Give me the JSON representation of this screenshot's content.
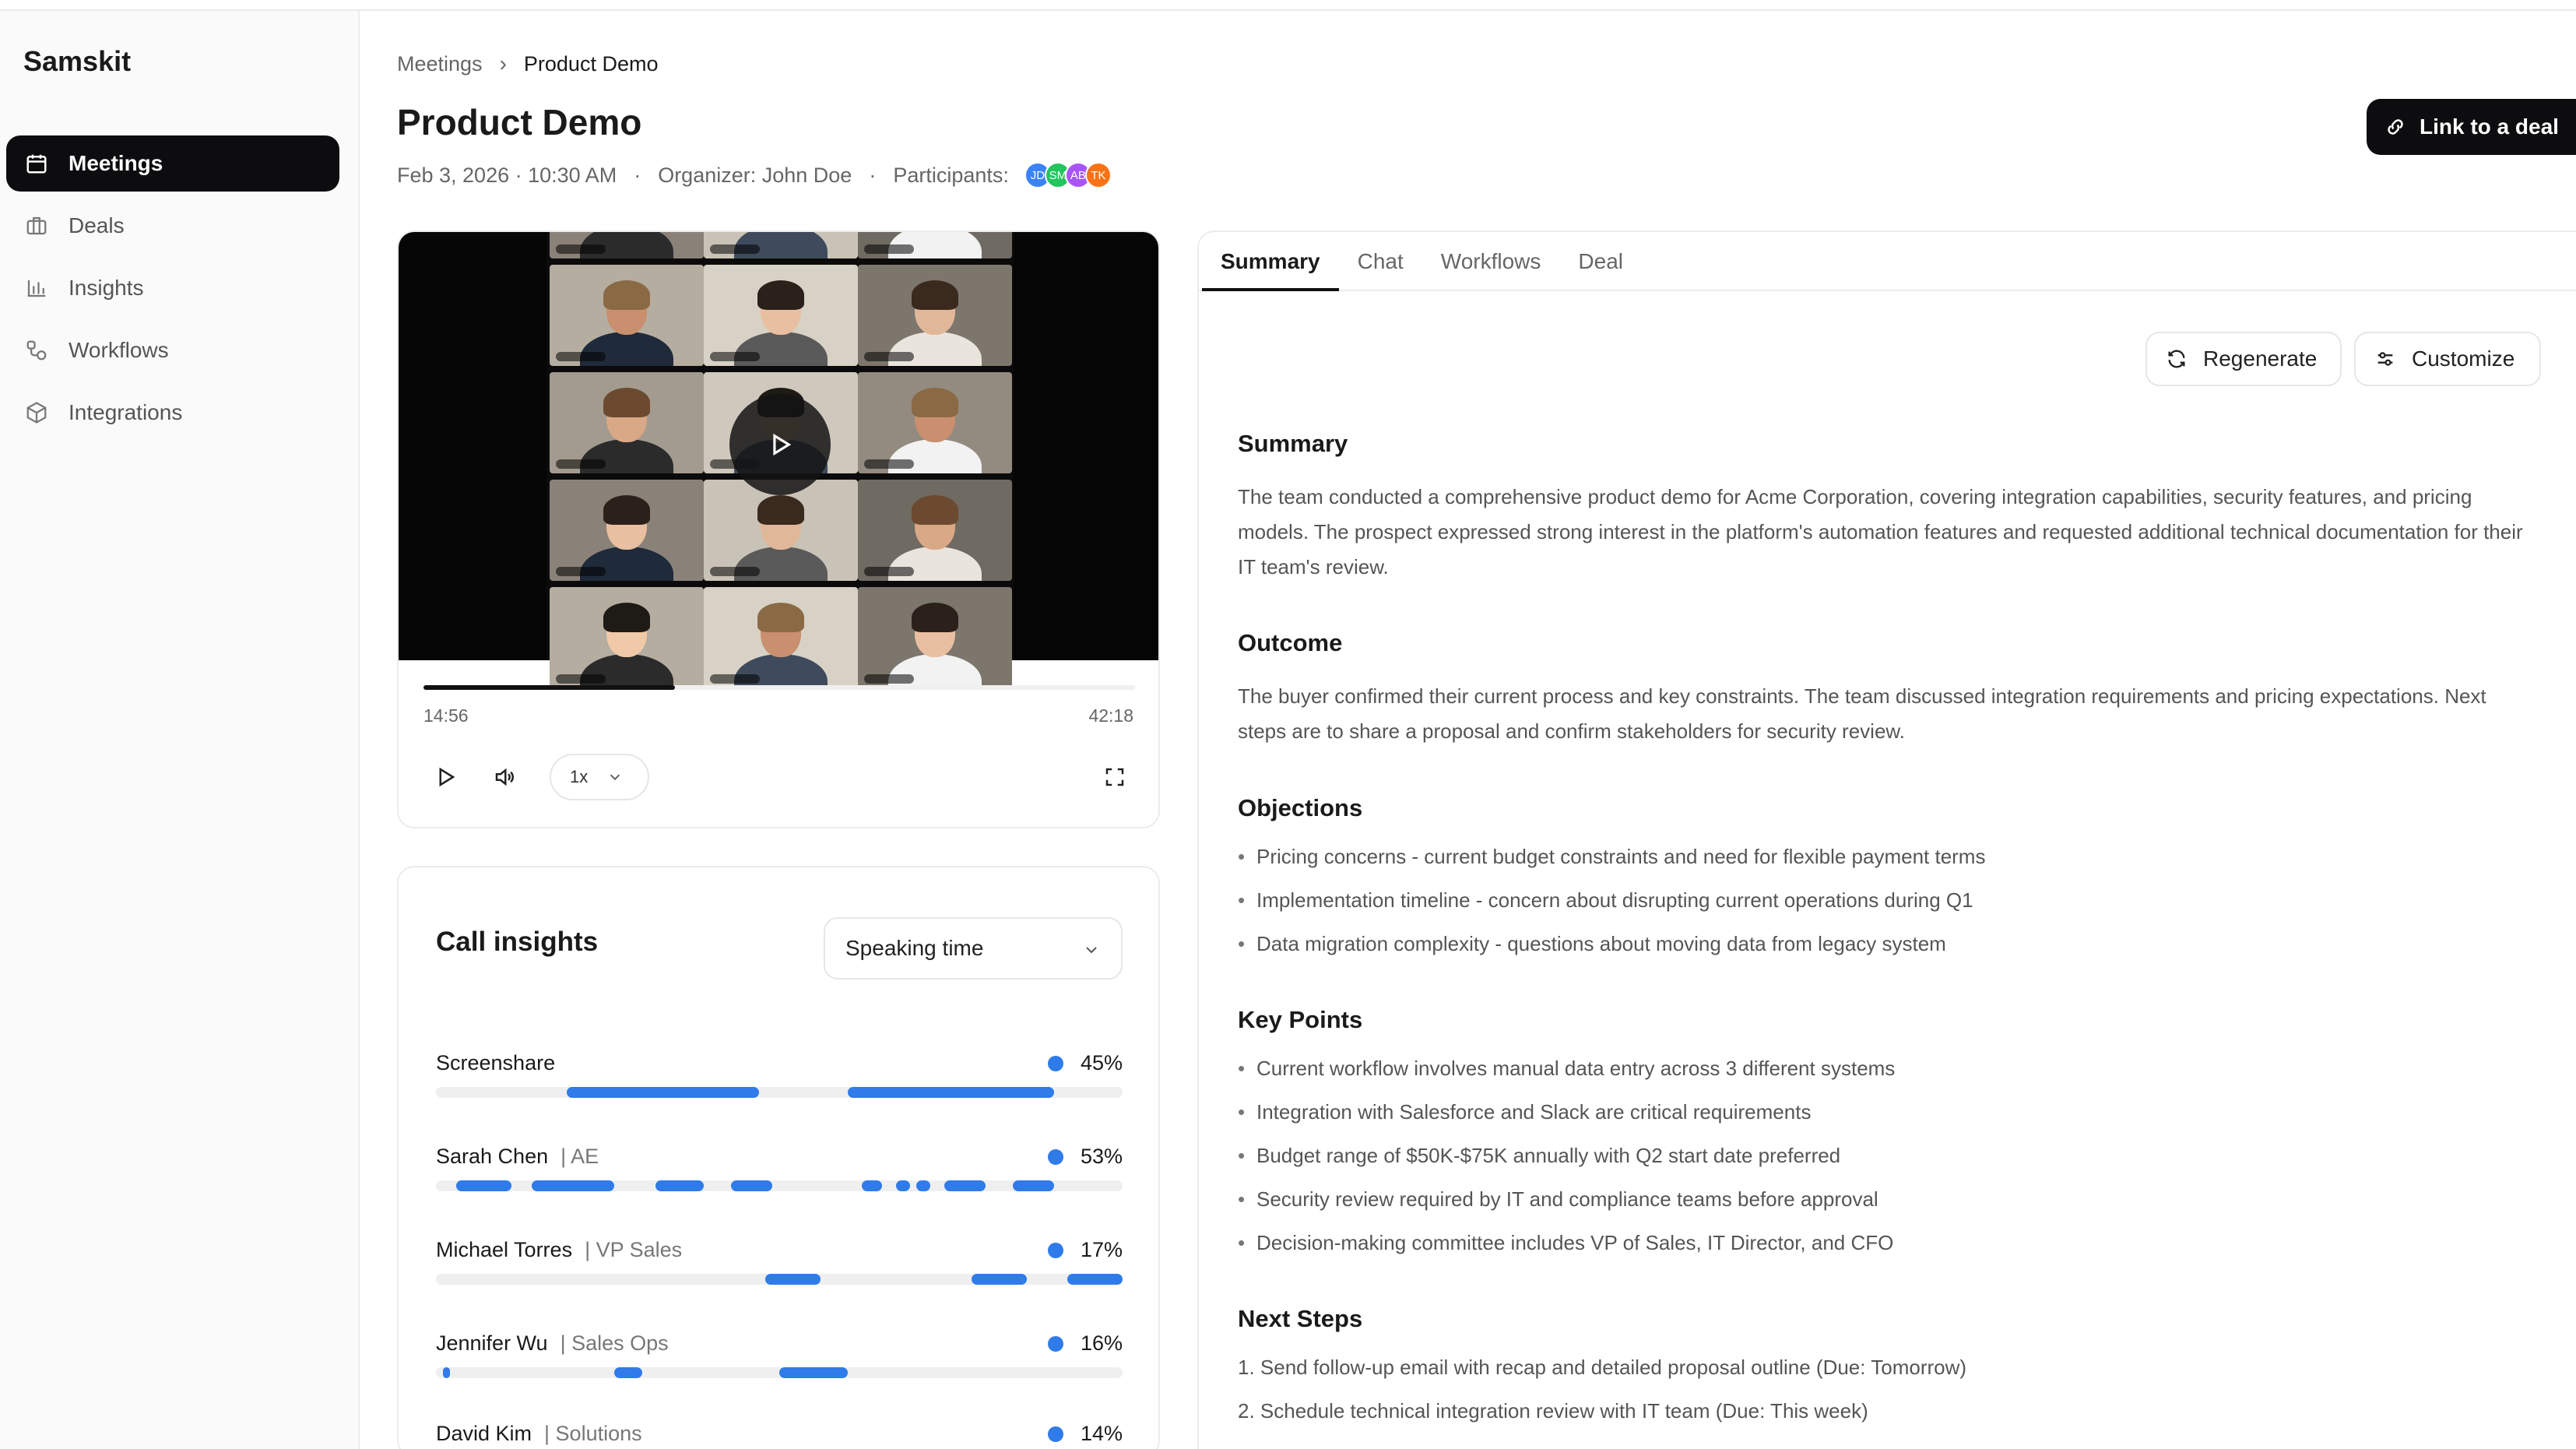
{
  "app": {
    "name": "Samskit"
  },
  "sidebar": {
    "items": [
      {
        "label": "Meetings",
        "icon": "calendar-icon",
        "active": true
      },
      {
        "label": "Deals",
        "icon": "briefcase-icon",
        "active": false
      },
      {
        "label": "Insights",
        "icon": "bar-chart-icon",
        "active": false
      },
      {
        "label": "Workflows",
        "icon": "workflow-icon",
        "active": false
      },
      {
        "label": "Integrations",
        "icon": "box-icon",
        "active": false
      }
    ]
  },
  "header": {
    "breadcrumb": {
      "parent": "Meetings",
      "current": "Product Demo"
    },
    "title": "Product Demo",
    "date": "Feb 3, 2026 · 10:30 AM",
    "organizer": "Organizer: John Doe",
    "participants_label": "Participants:",
    "participants": [
      {
        "initials": "JD",
        "color": "#3b82f6"
      },
      {
        "initials": "SM",
        "color": "#22c55e"
      },
      {
        "initials": "AB",
        "color": "#a855f7"
      },
      {
        "initials": "TK",
        "color": "#f97316"
      }
    ],
    "link_deal_label": "Link to a deal"
  },
  "player": {
    "current_time": "14:56",
    "total_time": "42:18",
    "progress": 0.353,
    "speed": "1x"
  },
  "insights": {
    "title": "Call insights",
    "metric": "Speaking time",
    "speakers": [
      {
        "name": "Screenshare",
        "role": "",
        "percent": "45%",
        "segments": [
          [
            0.19,
            0.47
          ],
          [
            0.6,
            0.9
          ]
        ]
      },
      {
        "name": "Sarah Chen",
        "role": "| AE",
        "percent": "53%",
        "segments": [
          [
            0.03,
            0.11
          ],
          [
            0.14,
            0.26
          ],
          [
            0.32,
            0.39
          ],
          [
            0.43,
            0.49
          ],
          [
            0.62,
            0.65
          ],
          [
            0.67,
            0.69
          ],
          [
            0.7,
            0.72
          ],
          [
            0.74,
            0.8
          ],
          [
            0.84,
            0.9
          ]
        ]
      },
      {
        "name": "Michael Torres",
        "role": "| VP Sales",
        "percent": "17%",
        "segments": [
          [
            0.48,
            0.56
          ],
          [
            0.78,
            0.86
          ],
          [
            0.92,
            1.0
          ]
        ]
      },
      {
        "name": "Jennifer Wu",
        "role": "| Sales Ops",
        "percent": "16%",
        "segments": [
          [
            0.01,
            0.02
          ],
          [
            0.26,
            0.3
          ],
          [
            0.5,
            0.6
          ]
        ]
      },
      {
        "name": "David Kim",
        "role": "| Solutions",
        "percent": "14%",
        "segments": []
      }
    ]
  },
  "panel": {
    "tabs": [
      "Summary",
      "Chat",
      "Workflows",
      "Deal"
    ],
    "active_tab": "Summary",
    "regenerate_label": "Regenerate",
    "customize_label": "Customize",
    "summary": {
      "title": "Summary",
      "text": "The team conducted a comprehensive product demo for Acme Corporation, covering integration capabilities, security features, and pricing models. The prospect expressed strong interest in the platform's automation features and requested additional technical documentation for their IT team's review."
    },
    "outcome": {
      "title": "Outcome",
      "text": "The buyer confirmed their current process and key constraints. The team discussed integration requirements and pricing expectations. Next steps are to share a proposal and confirm stakeholders for security review."
    },
    "objections": {
      "title": "Objections",
      "items": [
        "Pricing concerns - current budget constraints and need for flexible payment terms",
        "Implementation timeline - concern about disrupting current operations during Q1",
        "Data migration complexity - questions about moving data from legacy system"
      ]
    },
    "key_points": {
      "title": "Key Points",
      "items": [
        "Current workflow involves manual data entry across 3 different systems",
        "Integration with Salesforce and Slack are critical requirements",
        "Budget range of $50K-$75K annually with Q2 start date preferred",
        "Security review required by IT and compliance teams before approval",
        "Decision-making committee includes VP of Sales, IT Director, and CFO"
      ]
    },
    "next_steps": {
      "title": "Next Steps",
      "items": [
        "1.  Send follow-up email with recap and detailed proposal outline (Due: Tomorrow)",
        "2.  Schedule technical integration review with IT team (Due: This week)"
      ]
    }
  }
}
